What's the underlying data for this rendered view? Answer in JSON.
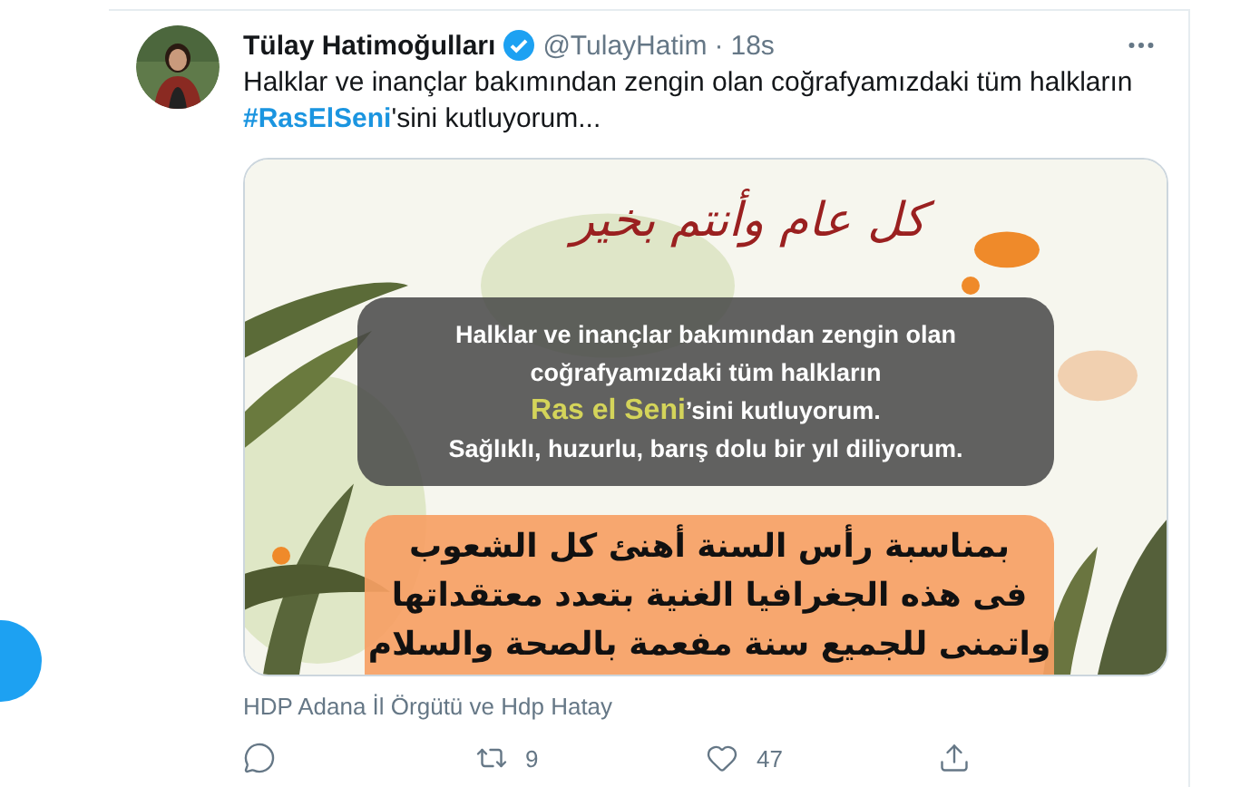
{
  "author": {
    "name": "Tülay Hatimoğulları",
    "verified": true,
    "handle": "@TulayHatim",
    "separator": "·",
    "time": "18s"
  },
  "text": {
    "before": "Halklar ve inançlar bakımından zengin olan coğrafyamızdaki tüm halkların",
    "hashtag": "#RasElSeni",
    "after": "'sini kutluyorum..."
  },
  "image": {
    "kind": "picture",
    "calligraphy": "كل عام وأنتم بخير",
    "overlay_lines": [
      {
        "text": "Halklar ve inançlar bakımından zengin olan"
      },
      {
        "text": "coğrafyamızdaki tüm halkların"
      },
      {
        "highlight": "Ras el Seni",
        "text": "’sini kutluyorum."
      },
      {
        "text": "Sağlıklı, huzurlu, barış dolu bir yıl diliyorum."
      }
    ],
    "arabic_lines": [
      "بمناسبة رأس السنة أهنئ كل الشعوب",
      "فى هذه الجغرافيا الغنية بتعدد معتقداتها",
      "واتمنى للجميع سنة مفعمة بالصحة والسلام"
    ]
  },
  "caption": "HDP Adana İl Örgütü ve Hdp Hatay",
  "actions": [
    {
      "kind": "reply"
    },
    {
      "kind": "retweet",
      "count": "9"
    },
    {
      "kind": "like",
      "count": "47"
    },
    {
      "kind": "share"
    }
  ]
}
